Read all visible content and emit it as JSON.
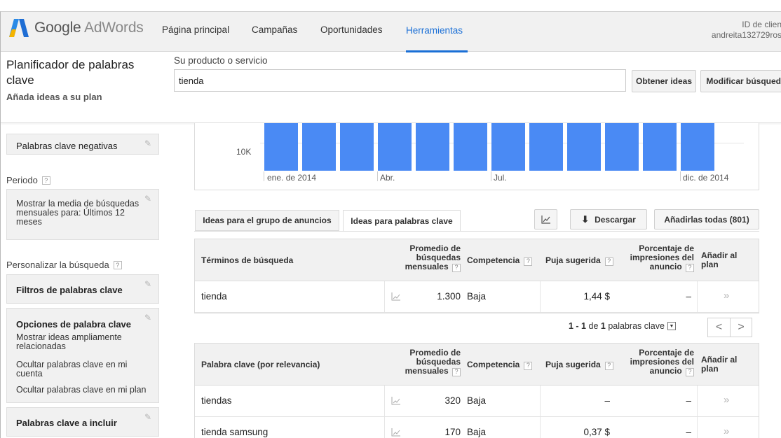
{
  "nav": {
    "logo_google": "Google",
    "logo_product": "AdWords",
    "items": [
      "Página principal",
      "Campañas",
      "Oportunidades",
      "Herramientas"
    ],
    "active": "Herramientas",
    "client_id_label": "ID de clien",
    "client_user": "andreita132729ros"
  },
  "header": {
    "title": "Planificador de palabras clave",
    "subtitle": "Añada ideas a su plan",
    "search_label": "Su producto o servicio",
    "search_value": "tienda",
    "get_ideas": "Obtener ideas",
    "modify_search": "Modificar búsqueda"
  },
  "sidebar": {
    "negatives": "Palabras clave negativas",
    "period_label": "Periodo",
    "period_desc": "Mostrar la media de búsquedas mensuales para: Últimos 12 meses",
    "customize_label": "Personalizar la búsqueda",
    "filters": "Filtros de palabras clave",
    "options_title": "Opciones de palabra clave",
    "options_lines": [
      "Mostrar ideas ampliamente relacionadas",
      "Ocultar palabras clave en mi cuenta",
      "Ocultar palabras clave en mi plan"
    ],
    "include": "Palabras clave a incluir",
    "help": "?"
  },
  "chart": {
    "y_tick": "10K",
    "x_labels": [
      "ene. de 2014",
      "Abr.",
      "Jul.",
      "dic. de 2014"
    ]
  },
  "tabs": {
    "adgroup": "Ideas para el grupo de anuncios",
    "keyword": "Ideas para palabras clave",
    "download": "Descargar",
    "add_all": "Añadirlas todas (801)"
  },
  "table1": {
    "headers": {
      "term": "Términos de búsqueda",
      "avg": "Promedio de búsquedas mensuales",
      "competition": "Competencia",
      "bid": "Puja sugerida",
      "impr": "Porcentaje de impresiones del anuncio",
      "add": "Añadir al plan"
    },
    "rows": [
      {
        "keyword": "tienda",
        "avg": "1.300",
        "competition": "Baja",
        "bid": "1,44 $",
        "impr": "–",
        "add": "»"
      }
    ]
  },
  "pager": {
    "range": "1 - 1",
    "of": "de",
    "total": "1",
    "unit": "palabras clave",
    "prev": "<",
    "next": ">"
  },
  "table2": {
    "headers": {
      "term": "Palabra clave (por relevancia)",
      "avg": "Promedio de búsquedas mensuales",
      "competition": "Competencia",
      "bid": "Puja sugerida",
      "impr": "Porcentaje de impresiones del anuncio",
      "add": "Añadir al plan"
    },
    "rows": [
      {
        "keyword": "tiendas",
        "avg": "320",
        "competition": "Baja",
        "bid": "–",
        "impr": "–",
        "add": "»"
      },
      {
        "keyword": "tienda samsung",
        "avg": "170",
        "competition": "Baja",
        "bid": "0,37 $",
        "impr": "–",
        "add": "»"
      }
    ]
  },
  "colors": {
    "accent": "#1a6fd6",
    "bar": "#4a8af4"
  }
}
